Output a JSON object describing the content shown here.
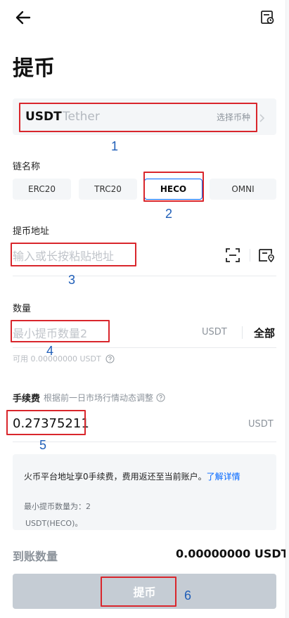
{
  "header": {
    "title": "提币",
    "back_icon": "back-arrow-icon",
    "record_icon": "record-icon"
  },
  "currency": {
    "code": "USDT",
    "name": "Tether",
    "select_label": "选择币种"
  },
  "chain": {
    "label": "链名称",
    "options": [
      "ERC20",
      "TRC20",
      "HECO",
      "OMNI"
    ],
    "selected": "HECO"
  },
  "address": {
    "label": "提币地址",
    "placeholder": "输入或长按粘贴地址"
  },
  "amount": {
    "label": "数量",
    "placeholder": "最小提币数量2",
    "unit": "USDT",
    "all_label": "全部",
    "available": "可用 0.00000000 USDT"
  },
  "fee": {
    "label": "手续费",
    "note": "根据前一日市场行情动态调整",
    "value": "0.27375211",
    "unit": "USDT"
  },
  "notice": {
    "text": "火币平台地址享0手续费，费用返还至当前账户。",
    "learn_more": "了解详情",
    "min_label": "最小提币数量为：2",
    "min_value": "USDT(HECO)。"
  },
  "received": {
    "label": "到账数量",
    "value": "0.00000000 USDT"
  },
  "submit": {
    "label": "提币"
  },
  "annotations": [
    "1",
    "2",
    "3",
    "4",
    "5",
    "6"
  ],
  "colors": {
    "accent": "#0066ff",
    "annotation_box": "#d9262c",
    "annotation_number": "#1f5eb8",
    "button_disabled": "#c5ccd4"
  }
}
